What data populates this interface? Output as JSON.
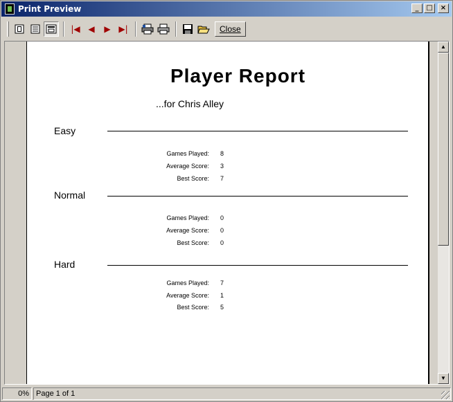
{
  "window": {
    "title": "Print Preview"
  },
  "title_buttons": {
    "minimize": "_",
    "maximize": "□",
    "close": "×"
  },
  "toolbar": {
    "close_label": "Close",
    "icons": [
      "one-page-icon",
      "multi-page-icon",
      "zoom-icon",
      "first-page-icon",
      "prev-page-icon",
      "next-page-icon",
      "last-page-icon",
      "print-setup-icon",
      "print-icon",
      "save-icon",
      "open-icon"
    ]
  },
  "report": {
    "title": "Player Report",
    "subtitle": "...for Chris Alley",
    "sections": [
      {
        "label": "Easy",
        "stats": [
          {
            "label": "Games Played:",
            "value": "8"
          },
          {
            "label": "Average Score:",
            "value": "3"
          },
          {
            "label": "Best Score:",
            "value": "7"
          }
        ]
      },
      {
        "label": "Normal",
        "stats": [
          {
            "label": "Games Played:",
            "value": "0"
          },
          {
            "label": "Average Score:",
            "value": "0"
          },
          {
            "label": "Best Score:",
            "value": "0"
          }
        ]
      },
      {
        "label": "Hard",
        "stats": [
          {
            "label": "Games Played:",
            "value": "7"
          },
          {
            "label": "Average Score:",
            "value": "1"
          },
          {
            "label": "Best Score:",
            "value": "5"
          }
        ]
      }
    ]
  },
  "status": {
    "progress": "0%",
    "page_info": "Page 1 of 1"
  },
  "colors": {
    "titlebar_start": "#0a246a",
    "titlebar_end": "#a6caf0",
    "face": "#d4d0c8",
    "nav_arrow": "#a00000"
  }
}
